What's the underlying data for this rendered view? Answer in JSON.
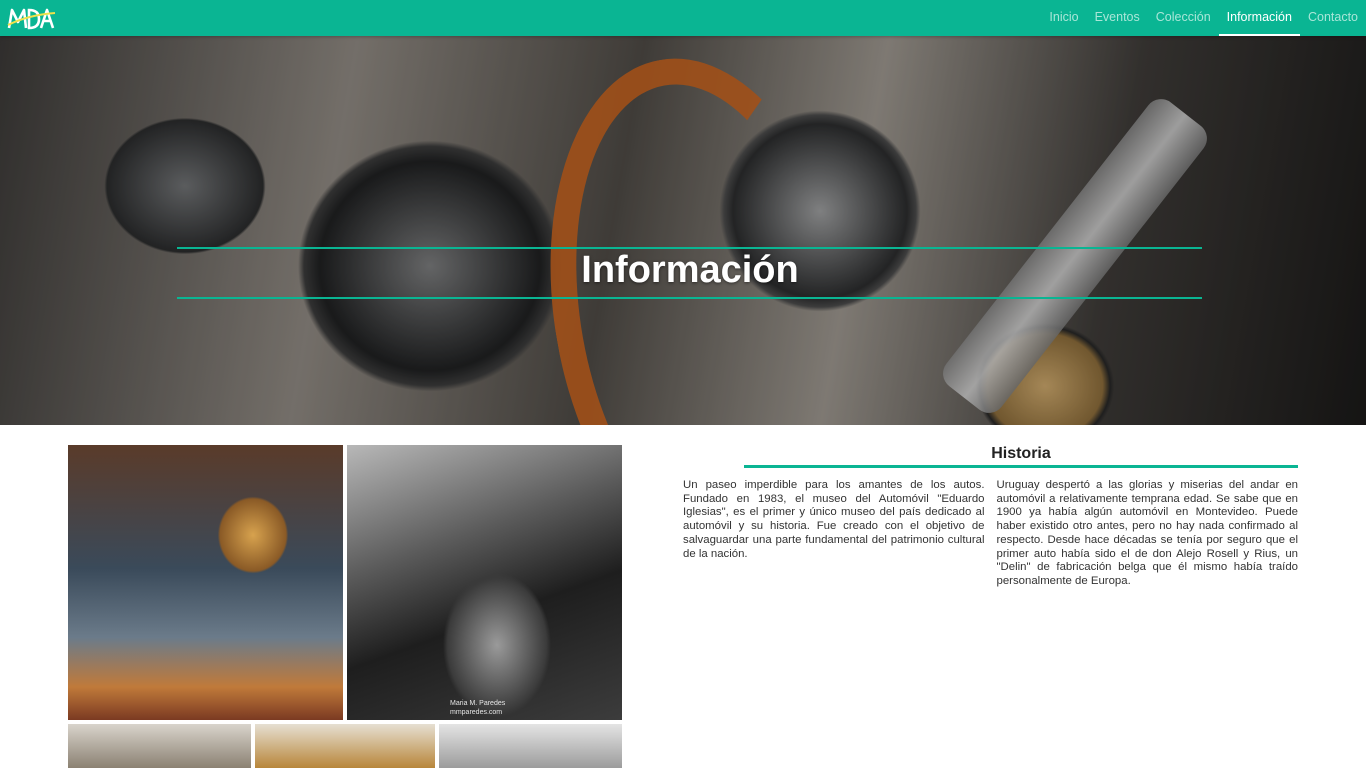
{
  "brand": {
    "logo_text": "MDA",
    "accent_color": "#0ab593"
  },
  "nav": {
    "items": [
      {
        "label": "Inicio"
      },
      {
        "label": "Eventos"
      },
      {
        "label": "Colección"
      },
      {
        "label": "Información",
        "active": true
      },
      {
        "label": "Contacto"
      }
    ]
  },
  "hero": {
    "title": "Información"
  },
  "gallery": {
    "caption": "Maria M. Paredes\nmmparedes.com"
  },
  "historia": {
    "title": "Historia",
    "paragraphs": [
      "Un paseo imperdible para los amantes de los autos. Fundado en 1983, el museo del Automóvil \"Eduardo Iglesias\", es el primer y único museo del país dedicado al automóvil y su historia. Fue creado con el objetivo de salvaguardar una parte fundamental del patrimonio cultural de la nación.",
      "Uruguay despertó a las glorias y miserias del andar en automóvil a relativamente temprana edad. Se sabe que en 1900 ya había algún automóvil en Montevideo. Puede haber existido otro antes, pero no hay nada confirmado al respecto. Desde hace décadas se tenía por seguro que el primer auto había sido el de don Alejo Rosell y Rius, un \"Delin\" de fabricación belga que él mismo había traído personalmente de Europa."
    ]
  }
}
